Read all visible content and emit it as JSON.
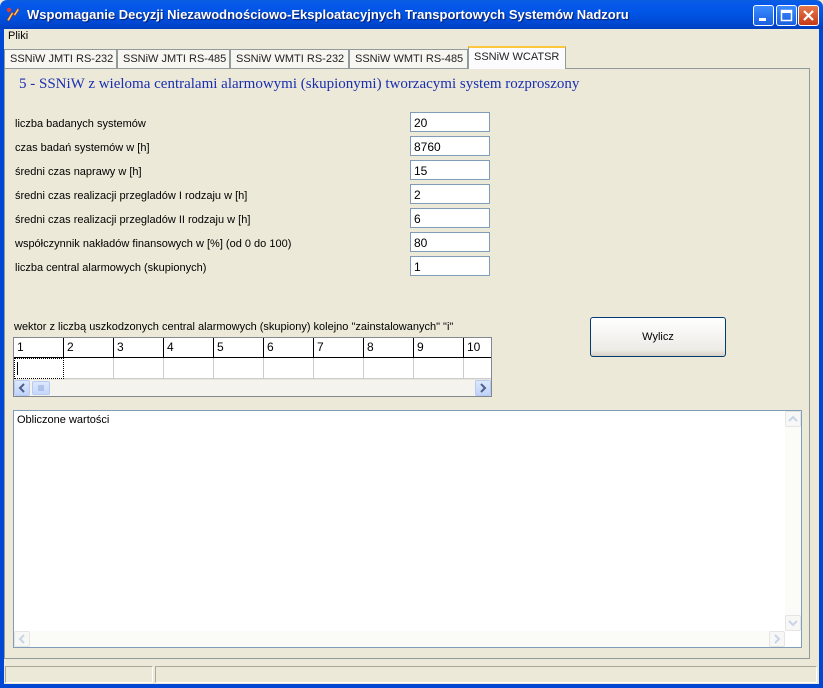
{
  "window": {
    "title": "Wspomaganie Decyzji Niezawodnościowo-Eksploatacyjnych Transportowych Systemów Nadzoru"
  },
  "menu": {
    "items": [
      "Pliki"
    ]
  },
  "tabs": [
    {
      "label": "SSNiW JMTI RS-232"
    },
    {
      "label": "SSNiW JMTI RS-485"
    },
    {
      "label": "SSNiW WMTI RS-232"
    },
    {
      "label": "SSNiW WMTI RS-485"
    },
    {
      "label": "SSNiW WCATSR"
    }
  ],
  "active_tab": "SSNiW WCATSR",
  "panel": {
    "heading": "5 - SSNiW z wieloma centralami alarmowymi (skupionymi) tworzacymi system rozproszony",
    "fields": [
      {
        "label": "liczba badanych systemów",
        "value": "20"
      },
      {
        "label": "czas badań systemów w [h]",
        "value": "8760"
      },
      {
        "label": "średni czas naprawy w [h]",
        "value": "15"
      },
      {
        "label": "średni czas realizacji przegladów I rodzaju w [h]",
        "value": "2"
      },
      {
        "label": "średni czas realizacji przegladów II rodzaju w [h]",
        "value": "6"
      },
      {
        "label": "współczynnik nakładów finansowych w [%] (od 0 do 100)",
        "value": "80"
      },
      {
        "label": "liczba central alarmowych (skupionych)",
        "value": "1"
      }
    ],
    "vector_label": "wektor z liczbą uszkodzonych central alarmowych (skupiony) kolejno \"zainstalowanych\" \"i\"",
    "grid_headers": [
      "1",
      "2",
      "3",
      "4",
      "5",
      "6",
      "7",
      "8",
      "9",
      "10"
    ],
    "calc_button": "Wylicz",
    "results_text": "Obliczone wartości"
  },
  "colors": {
    "titlebar": "#0055e5",
    "heading": "#1a2fb0",
    "active_tab_accent": "#ffc83c"
  }
}
